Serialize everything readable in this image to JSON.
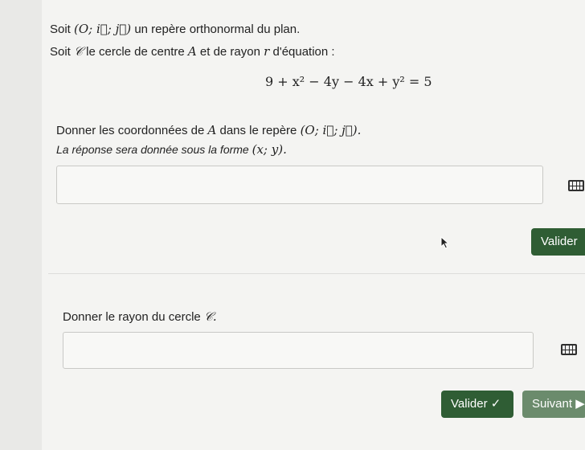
{
  "intro": {
    "line1_prefix": "Soit",
    "line1_math": "(O; i⃗; j⃗)",
    "line1_suffix": "un repère orthonormal du plan.",
    "line2_prefix": "Soit",
    "line2_math_c": "𝒞",
    "line2_mid": "le cercle de centre",
    "line2_math_a": "A",
    "line2_mid2": "et de rayon",
    "line2_math_r": "r",
    "line2_suffix": "d'équation :"
  },
  "equation": {
    "text": "9 + x² − 4y − 4x + y² = 5"
  },
  "question1": {
    "prefix": "Donner les coordonnées de",
    "math_a": "A",
    "mid": "dans le repère",
    "math_frame": "(O; i⃗; j⃗).",
    "hint_prefix": "La réponse sera donnée sous la forme",
    "hint_math": "(x; y).",
    "input_value": "",
    "keyboard_icon": "keyboard-icon",
    "submit_label": "Valider"
  },
  "question2": {
    "prefix": "Donner le rayon du cercle",
    "math_c": "𝒞.",
    "input_value": "",
    "keyboard_icon": "keyboard-icon",
    "submit_label": "Valider ✓",
    "next_label": "Suivant ▶"
  },
  "colors": {
    "primary_button": "#2f5d34",
    "secondary_button": "#6b8b6c"
  }
}
